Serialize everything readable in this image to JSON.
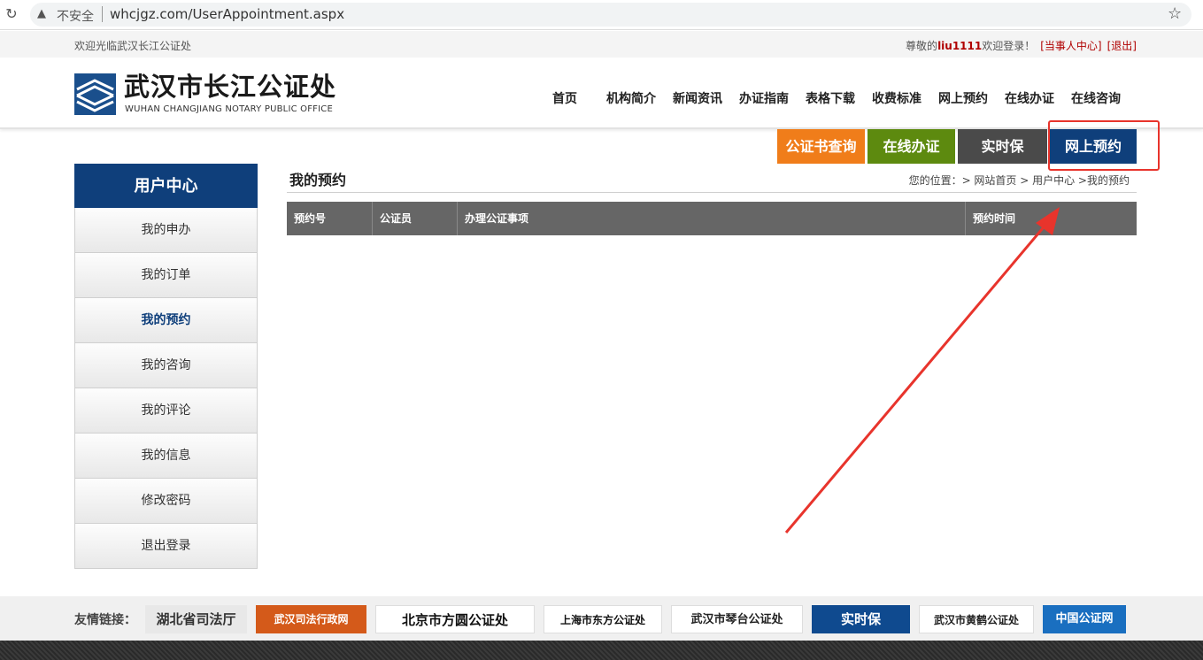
{
  "browser": {
    "insecure_label": "不安全",
    "url": "whcjgz.com/UserAppointment.aspx"
  },
  "topbar": {
    "welcome": "欢迎光临武汉长江公证处",
    "greet_prefix": "尊敬的",
    "username": "liu1111",
    "greet_suffix": "欢迎登录！",
    "party_center": "[当事人中心]",
    "logout": "[退出]"
  },
  "header": {
    "logo_cn": "武汉市长江公证处",
    "logo_en": "WUHAN CHANGJIANG NOTARY PUBLIC OFFICE",
    "nav": [
      "首页",
      "机构简介",
      "新闻资讯",
      "办证指南",
      "表格下载",
      "收费标准",
      "网上预约",
      "在线办证",
      "在线咨询"
    ]
  },
  "quick": {
    "buttons": [
      {
        "label": "公证书查询",
        "color": "#f07d1a"
      },
      {
        "label": "在线办证",
        "color": "#5d8a0f"
      },
      {
        "label": "实时保",
        "color": "#4a4a4a"
      },
      {
        "label": "网上预约",
        "color": "#0f3f7b"
      }
    ]
  },
  "sidebar": {
    "title": "用户中心",
    "items": [
      {
        "label": "我的申办"
      },
      {
        "label": "我的订单"
      },
      {
        "label": "我的预约",
        "active": true
      },
      {
        "label": "我的咨询"
      },
      {
        "label": "我的评论"
      },
      {
        "label": "我的信息"
      },
      {
        "label": "修改密码"
      },
      {
        "label": "退出登录"
      }
    ]
  },
  "main": {
    "title": "我的预约",
    "breadcrumb": "您的位置：> 网站首页 > 用户中心 >我的预约",
    "columns": [
      "预约号",
      "公证员",
      "办理公证事项",
      "预约时间"
    ]
  },
  "footer": {
    "label": "友情链接：",
    "links": [
      "湖北省司法厅",
      "武汉司法行政网",
      "北京市方圆公证处",
      "上海市东方公证处",
      "武汉市琴台公证处",
      "实时保",
      "武汉市黄鹤公证处",
      "中国公证网"
    ]
  },
  "colors": {
    "brand_blue": "#0f3f7b",
    "header_red": "#b00000",
    "annotation_red": "#e8342c"
  }
}
